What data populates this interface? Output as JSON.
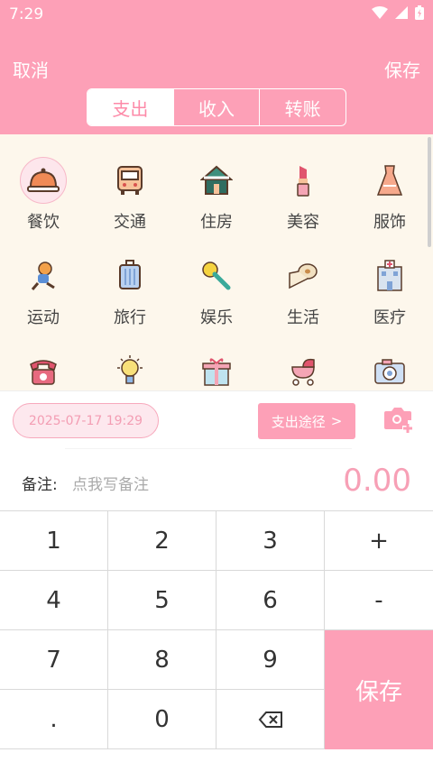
{
  "status": {
    "time": "7:29"
  },
  "nav": {
    "cancel": "取消",
    "save": "保存"
  },
  "tabs": [
    {
      "label": "支出",
      "active": true
    },
    {
      "label": "收入",
      "active": false
    },
    {
      "label": "转账",
      "active": false
    }
  ],
  "categories": [
    {
      "label": "餐饮",
      "icon": "dining-cloche-icon",
      "selected": true
    },
    {
      "label": "交通",
      "icon": "bus-icon"
    },
    {
      "label": "住房",
      "icon": "house-icon"
    },
    {
      "label": "美容",
      "icon": "lipstick-icon"
    },
    {
      "label": "服饰",
      "icon": "dress-icon"
    },
    {
      "label": "运动",
      "icon": "running-kid-icon"
    },
    {
      "label": "旅行",
      "icon": "suitcase-icon"
    },
    {
      "label": "娱乐",
      "icon": "microphone-icon"
    },
    {
      "label": "生活",
      "icon": "tissue-roll-icon"
    },
    {
      "label": "医疗",
      "icon": "hospital-icon"
    },
    {
      "label": "",
      "icon": "telephone-icon"
    },
    {
      "label": "",
      "icon": "lightbulb-icon"
    },
    {
      "label": "",
      "icon": "gift-icon"
    },
    {
      "label": "",
      "icon": "stroller-icon"
    },
    {
      "label": "",
      "icon": "camera-photo-icon"
    }
  ],
  "entry": {
    "date": "2025-07-17 19:29",
    "payment_method": "支出途径",
    "payment_arrow": ">",
    "note_label": "备注:",
    "note_placeholder": "点我写备注",
    "amount": "0.00"
  },
  "keypad": {
    "k1": "1",
    "k2": "2",
    "k3": "3",
    "plus": "+",
    "k4": "4",
    "k5": "5",
    "k6": "6",
    "minus": "-",
    "k7": "7",
    "k8": "8",
    "k9": "9",
    "dot": ".",
    "k0": "0",
    "save": "保存"
  },
  "colors": {
    "accent": "#fda0b7",
    "grid_bg": "#fdf7ec"
  }
}
